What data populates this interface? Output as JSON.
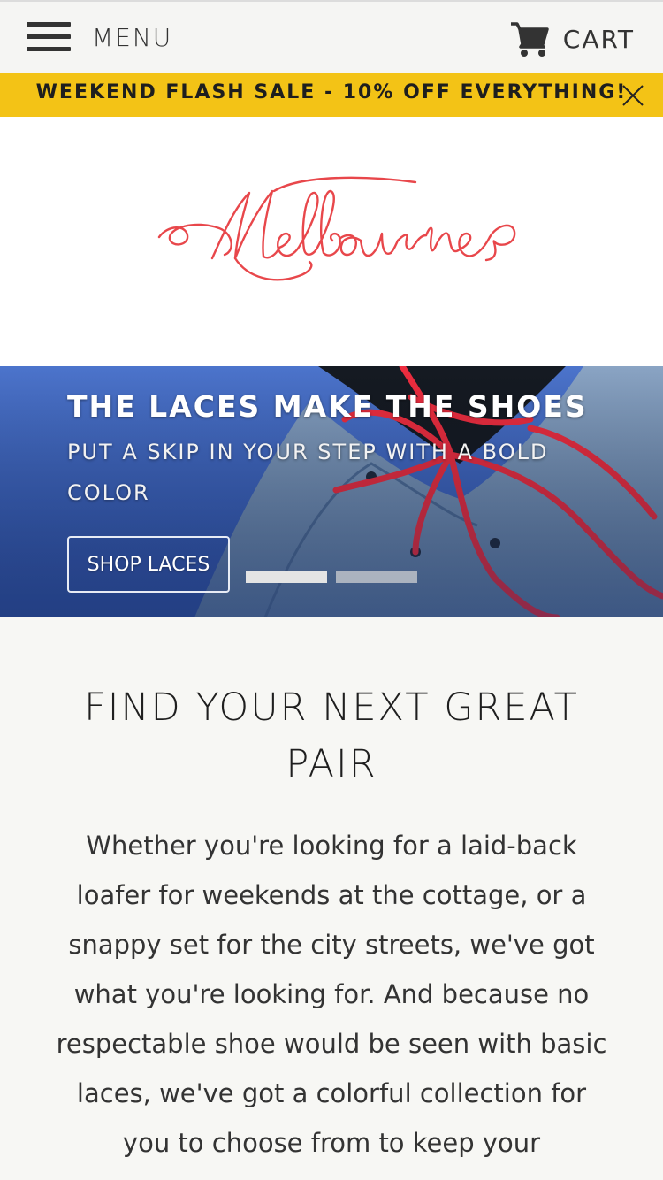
{
  "header": {
    "menu_label": "MENU",
    "cart_label": "CART"
  },
  "announcement": {
    "text": "WEEKEND FLASH SALE - 10% OFF EVERYTHING!"
  },
  "logo": {
    "brand_name": "Melbourne",
    "color": "#e8474b"
  },
  "hero": {
    "title": "THE LACES MAKE THE SHOES",
    "subtitle": "PUT A SKIP IN YOUR STEP WITH A BOLD COLOR",
    "button_label": "SHOP LACES",
    "slide_count": 2,
    "active_slide": 1,
    "lace_color": "#ee2d3f"
  },
  "intro": {
    "heading": "FIND YOUR NEXT GREAT PAIR",
    "body": "Whether you're looking for a laid-back loafer for weekends at the cottage, or a snappy set for the city streets, we've got what you're looking for. And because no respectable shoe would be seen with basic laces, we've got a colorful collection for you to choose from to keep your"
  },
  "colors": {
    "announcement_bg": "#f3c316",
    "page_bg": "#f7f7f4",
    "hero_bg": "#3c63bd"
  }
}
